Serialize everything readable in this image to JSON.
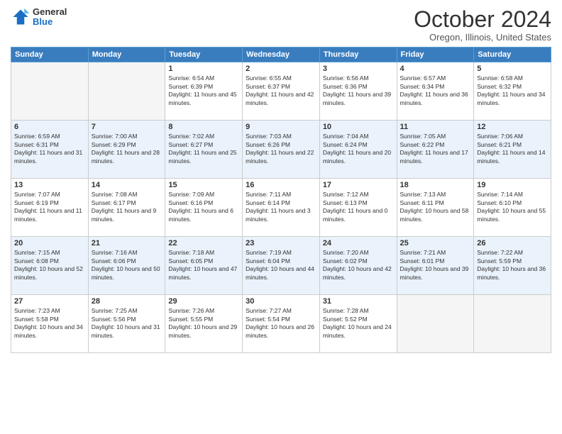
{
  "logo": {
    "general": "General",
    "blue": "Blue"
  },
  "header": {
    "month": "October 2024",
    "location": "Oregon, Illinois, United States"
  },
  "weekdays": [
    "Sunday",
    "Monday",
    "Tuesday",
    "Wednesday",
    "Thursday",
    "Friday",
    "Saturday"
  ],
  "weeks": [
    [
      {
        "day": "",
        "sunrise": "",
        "sunset": "",
        "daylight": ""
      },
      {
        "day": "",
        "sunrise": "",
        "sunset": "",
        "daylight": ""
      },
      {
        "day": "1",
        "sunrise": "Sunrise: 6:54 AM",
        "sunset": "Sunset: 6:39 PM",
        "daylight": "Daylight: 11 hours and 45 minutes."
      },
      {
        "day": "2",
        "sunrise": "Sunrise: 6:55 AM",
        "sunset": "Sunset: 6:37 PM",
        "daylight": "Daylight: 11 hours and 42 minutes."
      },
      {
        "day": "3",
        "sunrise": "Sunrise: 6:56 AM",
        "sunset": "Sunset: 6:36 PM",
        "daylight": "Daylight: 11 hours and 39 minutes."
      },
      {
        "day": "4",
        "sunrise": "Sunrise: 6:57 AM",
        "sunset": "Sunset: 6:34 PM",
        "daylight": "Daylight: 11 hours and 36 minutes."
      },
      {
        "day": "5",
        "sunrise": "Sunrise: 6:58 AM",
        "sunset": "Sunset: 6:32 PM",
        "daylight": "Daylight: 11 hours and 34 minutes."
      }
    ],
    [
      {
        "day": "6",
        "sunrise": "Sunrise: 6:59 AM",
        "sunset": "Sunset: 6:31 PM",
        "daylight": "Daylight: 11 hours and 31 minutes."
      },
      {
        "day": "7",
        "sunrise": "Sunrise: 7:00 AM",
        "sunset": "Sunset: 6:29 PM",
        "daylight": "Daylight: 11 hours and 28 minutes."
      },
      {
        "day": "8",
        "sunrise": "Sunrise: 7:02 AM",
        "sunset": "Sunset: 6:27 PM",
        "daylight": "Daylight: 11 hours and 25 minutes."
      },
      {
        "day": "9",
        "sunrise": "Sunrise: 7:03 AM",
        "sunset": "Sunset: 6:26 PM",
        "daylight": "Daylight: 11 hours and 22 minutes."
      },
      {
        "day": "10",
        "sunrise": "Sunrise: 7:04 AM",
        "sunset": "Sunset: 6:24 PM",
        "daylight": "Daylight: 11 hours and 20 minutes."
      },
      {
        "day": "11",
        "sunrise": "Sunrise: 7:05 AM",
        "sunset": "Sunset: 6:22 PM",
        "daylight": "Daylight: 11 hours and 17 minutes."
      },
      {
        "day": "12",
        "sunrise": "Sunrise: 7:06 AM",
        "sunset": "Sunset: 6:21 PM",
        "daylight": "Daylight: 11 hours and 14 minutes."
      }
    ],
    [
      {
        "day": "13",
        "sunrise": "Sunrise: 7:07 AM",
        "sunset": "Sunset: 6:19 PM",
        "daylight": "Daylight: 11 hours and 11 minutes."
      },
      {
        "day": "14",
        "sunrise": "Sunrise: 7:08 AM",
        "sunset": "Sunset: 6:17 PM",
        "daylight": "Daylight: 11 hours and 9 minutes."
      },
      {
        "day": "15",
        "sunrise": "Sunrise: 7:09 AM",
        "sunset": "Sunset: 6:16 PM",
        "daylight": "Daylight: 11 hours and 6 minutes."
      },
      {
        "day": "16",
        "sunrise": "Sunrise: 7:11 AM",
        "sunset": "Sunset: 6:14 PM",
        "daylight": "Daylight: 11 hours and 3 minutes."
      },
      {
        "day": "17",
        "sunrise": "Sunrise: 7:12 AM",
        "sunset": "Sunset: 6:13 PM",
        "daylight": "Daylight: 11 hours and 0 minutes."
      },
      {
        "day": "18",
        "sunrise": "Sunrise: 7:13 AM",
        "sunset": "Sunset: 6:11 PM",
        "daylight": "Daylight: 10 hours and 58 minutes."
      },
      {
        "day": "19",
        "sunrise": "Sunrise: 7:14 AM",
        "sunset": "Sunset: 6:10 PM",
        "daylight": "Daylight: 10 hours and 55 minutes."
      }
    ],
    [
      {
        "day": "20",
        "sunrise": "Sunrise: 7:15 AM",
        "sunset": "Sunset: 6:08 PM",
        "daylight": "Daylight: 10 hours and 52 minutes."
      },
      {
        "day": "21",
        "sunrise": "Sunrise: 7:16 AM",
        "sunset": "Sunset: 6:06 PM",
        "daylight": "Daylight: 10 hours and 50 minutes."
      },
      {
        "day": "22",
        "sunrise": "Sunrise: 7:18 AM",
        "sunset": "Sunset: 6:05 PM",
        "daylight": "Daylight: 10 hours and 47 minutes."
      },
      {
        "day": "23",
        "sunrise": "Sunrise: 7:19 AM",
        "sunset": "Sunset: 6:04 PM",
        "daylight": "Daylight: 10 hours and 44 minutes."
      },
      {
        "day": "24",
        "sunrise": "Sunrise: 7:20 AM",
        "sunset": "Sunset: 6:02 PM",
        "daylight": "Daylight: 10 hours and 42 minutes."
      },
      {
        "day": "25",
        "sunrise": "Sunrise: 7:21 AM",
        "sunset": "Sunset: 6:01 PM",
        "daylight": "Daylight: 10 hours and 39 minutes."
      },
      {
        "day": "26",
        "sunrise": "Sunrise: 7:22 AM",
        "sunset": "Sunset: 5:59 PM",
        "daylight": "Daylight: 10 hours and 36 minutes."
      }
    ],
    [
      {
        "day": "27",
        "sunrise": "Sunrise: 7:23 AM",
        "sunset": "Sunset: 5:58 PM",
        "daylight": "Daylight: 10 hours and 34 minutes."
      },
      {
        "day": "28",
        "sunrise": "Sunrise: 7:25 AM",
        "sunset": "Sunset: 5:56 PM",
        "daylight": "Daylight: 10 hours and 31 minutes."
      },
      {
        "day": "29",
        "sunrise": "Sunrise: 7:26 AM",
        "sunset": "Sunset: 5:55 PM",
        "daylight": "Daylight: 10 hours and 29 minutes."
      },
      {
        "day": "30",
        "sunrise": "Sunrise: 7:27 AM",
        "sunset": "Sunset: 5:54 PM",
        "daylight": "Daylight: 10 hours and 26 minutes."
      },
      {
        "day": "31",
        "sunrise": "Sunrise: 7:28 AM",
        "sunset": "Sunset: 5:52 PM",
        "daylight": "Daylight: 10 hours and 24 minutes."
      },
      {
        "day": "",
        "sunrise": "",
        "sunset": "",
        "daylight": ""
      },
      {
        "day": "",
        "sunrise": "",
        "sunset": "",
        "daylight": ""
      }
    ]
  ]
}
